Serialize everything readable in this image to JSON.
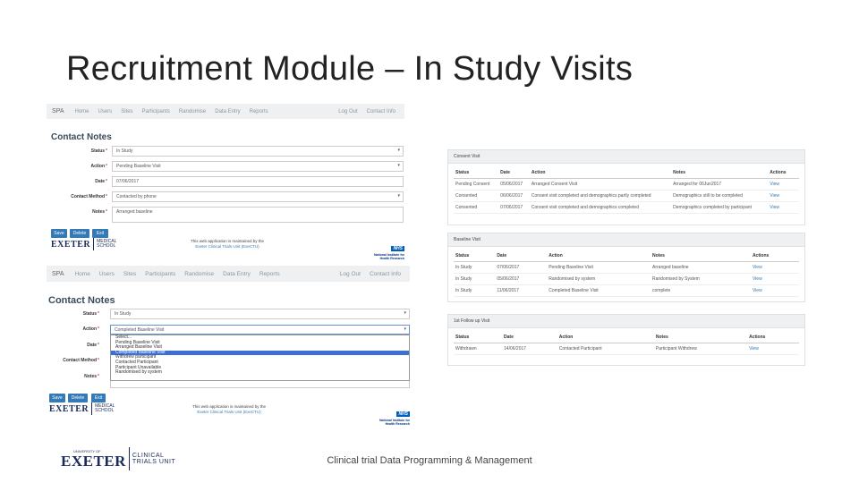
{
  "slide": {
    "title": "Recruitment Module – In Study Visits",
    "footer": "Clinical trial Data Programming & Management"
  },
  "logos": {
    "exeter_word": "EXETER",
    "medical_school_l1": "MEDICAL",
    "medical_school_l2": "SCHOOL",
    "uni_small": "UNIVERSITY OF",
    "clinical_l1": "CLINICAL",
    "clinical_l2": "TRIALS UNIT",
    "nhs": "NHS",
    "nihr_l1": "National Institute for",
    "nihr_l2": "Health Research"
  },
  "nav": {
    "brand": "SPA",
    "items": [
      "Home",
      "Users",
      "Sites",
      "Participants",
      "Randomise",
      "Data Entry",
      "Reports"
    ],
    "right": [
      "Log Out",
      "Contact Info"
    ]
  },
  "form_top": {
    "title": "Contact Notes",
    "status_label": "Status",
    "status_value": "In Study",
    "action_label": "Action",
    "action_value": "Pending Baseline Visit",
    "date_label": "Date",
    "date_value": "07/06/2017",
    "method_label": "Contact Method",
    "method_value": "Contacted by phone",
    "notes_label": "Notes",
    "notes_value": "Arranged baseline",
    "buttons": [
      "Save",
      "Delete",
      "Exit"
    ],
    "maintained_l1": "This web application is maintained by the",
    "maintained_l2": "Exeter Clinical Trials Unit (ExeCTU)"
  },
  "form_bottom": {
    "title": "Contact Notes",
    "status_label": "Status",
    "status_value": "In Study",
    "action_label": "Action",
    "action_value": "Completed Baseline Visit",
    "date_label": "Date",
    "method_label": "Contact Method",
    "notes_label": "Notes",
    "options": [
      "Select...",
      "Pending Baseline Visit",
      "Arranged Baseline Visit",
      "Completed Baseline Visit",
      "Withdrew participant",
      "Contacted Participant",
      "Participant Unavailable",
      "Randomised by system"
    ],
    "selected_index": 3,
    "buttons": [
      "Save",
      "Delete",
      "Exit"
    ],
    "maintained_l1": "This web application is maintained by the",
    "maintained_l2": "Exeter Clinical Trials Unit (ExeCTU)"
  },
  "panels": [
    {
      "title": "Consent Visit",
      "headers": [
        "Status",
        "Date",
        "Action",
        "Notes",
        "Actions"
      ],
      "rows": [
        [
          "Pending Consent",
          "05/06/2017",
          "Arranged Consent Visit",
          "Arranged for 06Jun2017",
          "View"
        ],
        [
          "Consented",
          "06/06/2017",
          "Consent visit completed and demographics partly completed",
          "Demographics still to be completed",
          "View"
        ],
        [
          "Consented",
          "07/06/2017",
          "Consent visit completed and demographics completed",
          "Demographics completed by participant",
          "View"
        ]
      ]
    },
    {
      "title": "Baseline Visit",
      "headers": [
        "Status",
        "Date",
        "Action",
        "Notes",
        "Actions"
      ],
      "rows": [
        [
          "In Study",
          "07/06/2017",
          "Pending Baseline Visit",
          "Arranged baseline",
          "View"
        ],
        [
          "In Study",
          "05/06/2017",
          "Randomised by system",
          "Randomised by System",
          "View"
        ],
        [
          "In Study",
          "11/06/2017",
          "Completed Baseline Visit",
          "complete",
          "View"
        ]
      ]
    },
    {
      "title": "1st Follow up Visit",
      "headers": [
        "Status",
        "Date",
        "Action",
        "Notes",
        "Actions"
      ],
      "rows": [
        [
          "Withdrawn",
          "14/06/2017",
          "Contacted Participant",
          "Participant Withdrew",
          "View"
        ]
      ]
    }
  ],
  "colors": {
    "primary_button": "#337ab7",
    "link": "#337ab7",
    "nav_background": "#eef0f2",
    "dropdown_selected": "#3c6fd6",
    "nhs_blue": "#005eb8"
  }
}
